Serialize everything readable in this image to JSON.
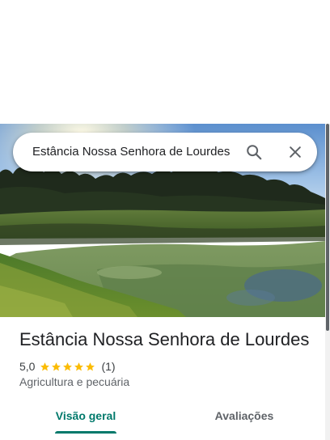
{
  "search": {
    "value": "Estância Nossa Senhora de Lourdes"
  },
  "place": {
    "name": "Estância Nossa Senhora de Lourdes",
    "rating": "5,0",
    "stars": 5,
    "review_count": "(1)",
    "category": "Agricultura e pecuária"
  },
  "tabs": [
    {
      "label": "Visão geral",
      "active": true
    },
    {
      "label": "Avaliações",
      "active": false
    }
  ],
  "colors": {
    "accent": "#00796b",
    "star": "#fbbc04",
    "text": "#202124",
    "secondary": "#5f6368"
  },
  "icons": {
    "search": "search-icon",
    "close": "close-icon",
    "star": "star-icon"
  }
}
